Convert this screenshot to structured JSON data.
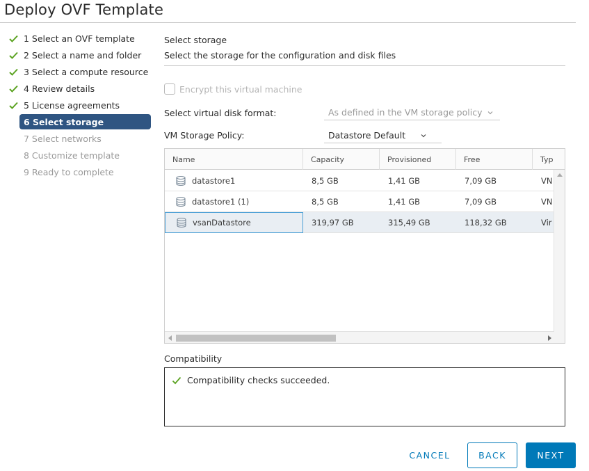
{
  "dialog": {
    "title": "Deploy OVF Template"
  },
  "steps": [
    {
      "label": "1 Select an OVF template",
      "state": "done"
    },
    {
      "label": "2 Select a name and folder",
      "state": "done"
    },
    {
      "label": "3 Select a compute resource",
      "state": "done"
    },
    {
      "label": "4 Review details",
      "state": "done"
    },
    {
      "label": "5 License agreements",
      "state": "done"
    },
    {
      "label": "6 Select storage",
      "state": "active"
    },
    {
      "label": "7 Select networks",
      "state": "todo"
    },
    {
      "label": "8 Customize template",
      "state": "todo"
    },
    {
      "label": "9 Ready to complete",
      "state": "todo"
    }
  ],
  "section": {
    "title": "Select storage",
    "description": "Select the storage for the configuration and disk files"
  },
  "encrypt": {
    "label": "Encrypt this virtual machine",
    "checked": false,
    "disabled": true
  },
  "disk_format": {
    "label": "Select virtual disk format:",
    "value": "As defined in the VM storage policy"
  },
  "storage_policy": {
    "label": "VM Storage Policy:",
    "value": "Datastore Default"
  },
  "grid": {
    "columns": [
      "Name",
      "Capacity",
      "Provisioned",
      "Free",
      "Typ"
    ],
    "rows": [
      {
        "name": "datastore1",
        "capacity": "8,5 GB",
        "provisioned": "1,41 GB",
        "free": "7,09 GB",
        "type": "VN"
      },
      {
        "name": "datastore1 (1)",
        "capacity": "8,5 GB",
        "provisioned": "1,41 GB",
        "free": "7,09 GB",
        "type": "VN"
      },
      {
        "name": "vsanDatastore",
        "capacity": "319,97 GB",
        "provisioned": "315,49 GB",
        "free": "118,32 GB",
        "type": "Vir",
        "selected": true
      }
    ]
  },
  "compatibility": {
    "title": "Compatibility",
    "message": "Compatibility checks succeeded."
  },
  "buttons": {
    "cancel": "CANCEL",
    "back": "BACK",
    "next": "NEXT"
  },
  "colors": {
    "accent": "#0079b8",
    "active_step": "#2f5582",
    "success": "#5aa220"
  }
}
